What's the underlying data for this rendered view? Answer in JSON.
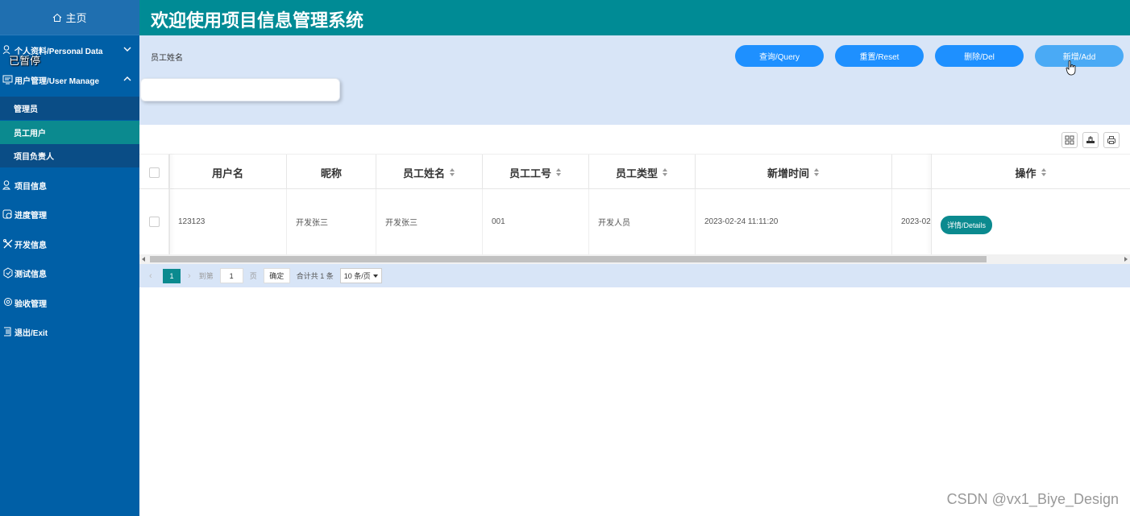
{
  "sidebar": {
    "home": "主页",
    "items": [
      {
        "label": "个人资料/Personal Data",
        "icon": "person-icon"
      },
      {
        "label": "用户管理/User Manage",
        "icon": "user-manage-icon"
      },
      {
        "label": "项目信息",
        "icon": "project-icon"
      },
      {
        "label": "进度管理",
        "icon": "progress-icon"
      },
      {
        "label": "开发信息",
        "icon": "dev-icon"
      },
      {
        "label": "测试信息",
        "icon": "test-icon"
      },
      {
        "label": "验收管理",
        "icon": "accept-icon"
      },
      {
        "label": "退出/Exit",
        "icon": "exit-icon"
      }
    ],
    "sub_items": [
      "管理员",
      "员工用户",
      "项目负责人"
    ],
    "active_sub": "员工用户"
  },
  "overlay": {
    "paused": "已暂停"
  },
  "header": {
    "title": "欢迎使用项目信息管理系统"
  },
  "search": {
    "label": "员工姓名",
    "value": "",
    "buttons": {
      "query": "查询/Query",
      "reset": "重置/Reset",
      "delete": "删除/Del",
      "add": "新增/Add"
    }
  },
  "table": {
    "columns": [
      "用户名",
      "昵称",
      "员工姓名",
      "员工工号",
      "员工类型",
      "新增时间",
      "操作"
    ],
    "rows": [
      {
        "username": "123123",
        "nickname": "开发张三",
        "name": "开发张三",
        "emp_no": "001",
        "type": "开发人员",
        "created": "2023-02-24 11:11:20",
        "extra": "2023-02",
        "action": "详情/Details"
      }
    ]
  },
  "pagination": {
    "current": "1",
    "goto_label": "到第",
    "goto_value": "1",
    "page_label": "页",
    "confirm": "确定",
    "total": "合计共 1 条",
    "page_size": "10 条/页"
  },
  "watermark": "CSDN @vx1_Biye_Design",
  "colors": {
    "sidebar": "#005fa6",
    "header": "#008b95",
    "accent": "#0b8a8f",
    "button": "#1e90ff",
    "panel": "#d8e5f7"
  }
}
